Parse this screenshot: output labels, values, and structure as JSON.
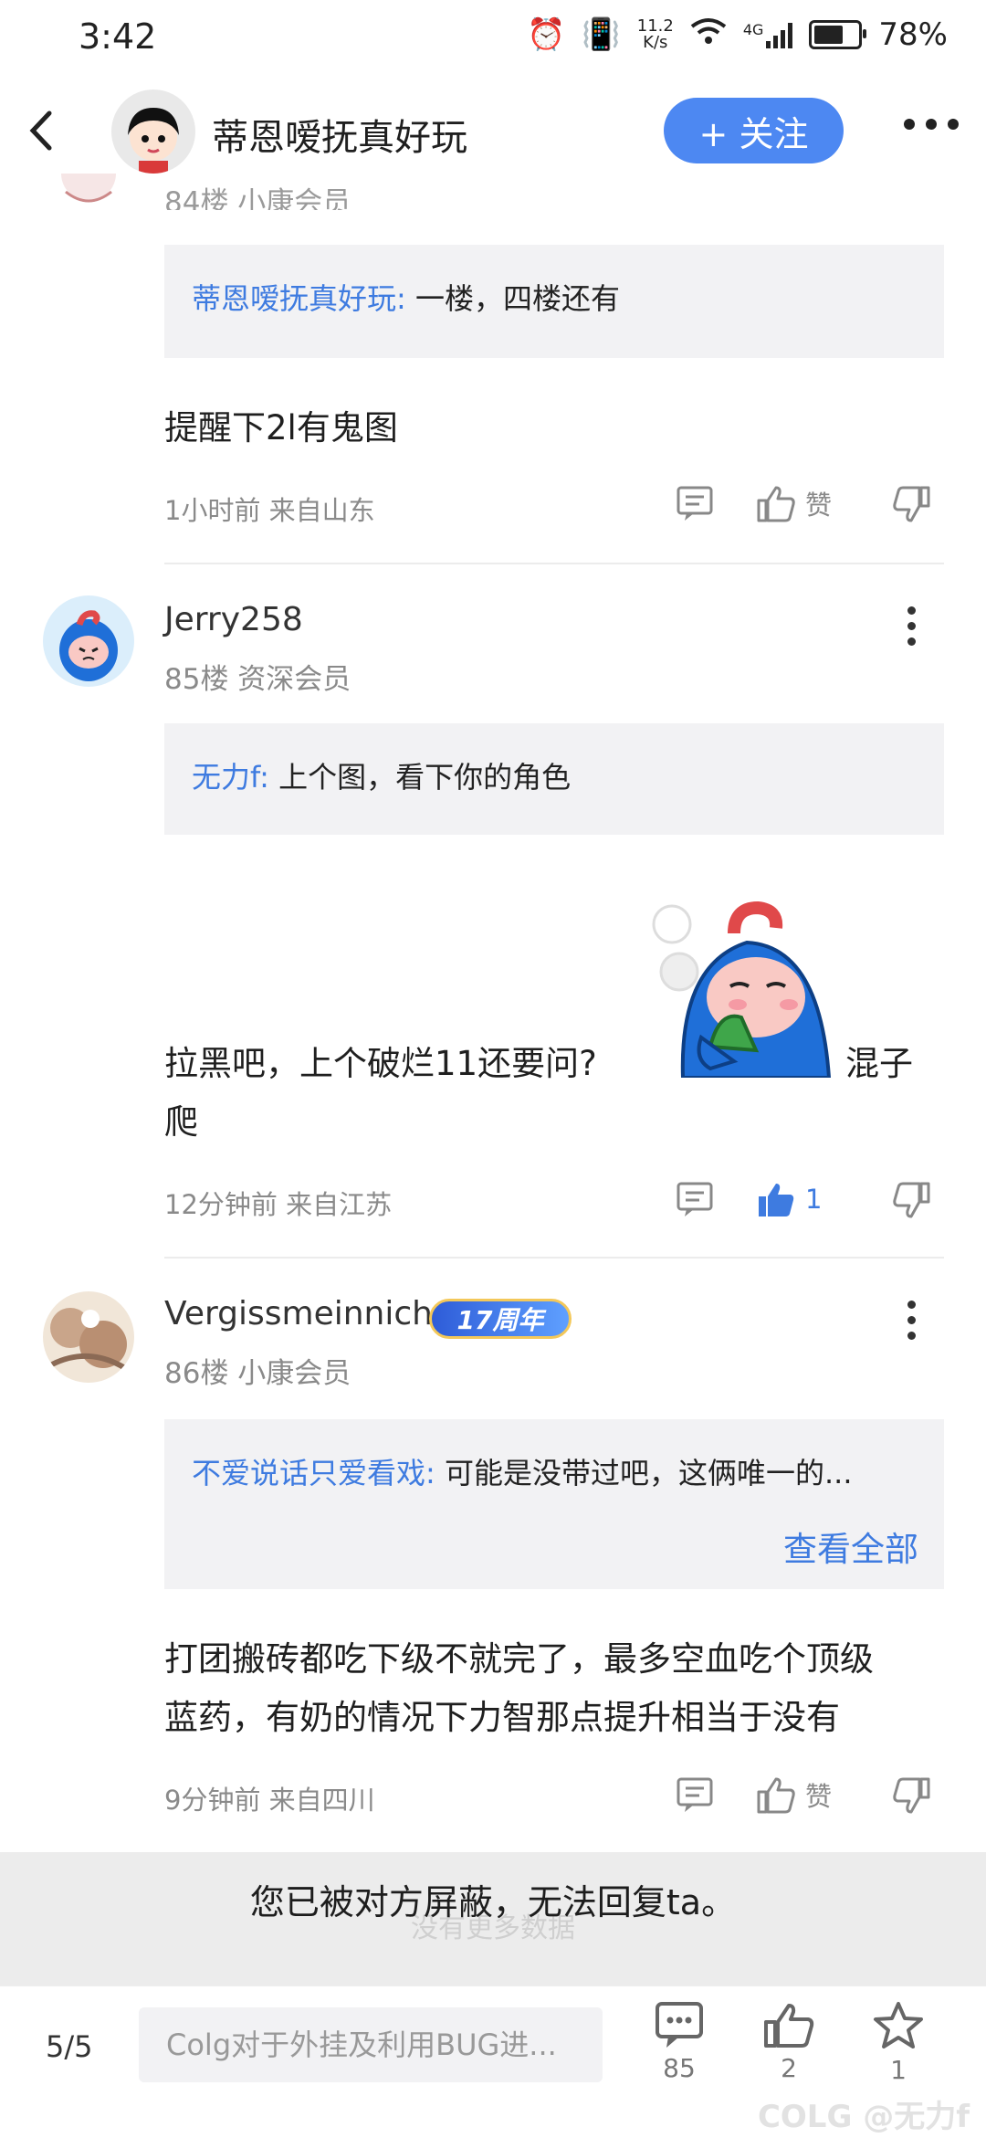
{
  "status_bar": {
    "time": "3:42",
    "net_speed_value": "11.2",
    "net_speed_unit": "K/s",
    "network": "4G",
    "battery": "78%",
    "battery_level": 0.78
  },
  "header": {
    "title": "蒂恩嗳抚真好玩",
    "follow_label": "+ 关注"
  },
  "post_84": {
    "meta": "84楼 小康会员",
    "quote_author": "蒂恩嗳抚真好玩:",
    "quote_text": "一楼，四楼还有",
    "content": "提醒下2l有鬼图",
    "time_location": "1小时前 来自山东",
    "like_label": "赞"
  },
  "post_85": {
    "username": "Jerry258",
    "meta": "85楼 资深会员",
    "quote_author": "无力f:",
    "quote_text": "上个图，看下你的角色",
    "content_line1": "拉黑吧，上个破烂11还要问?",
    "content_after_sticker": "混子",
    "content_line2": "爬",
    "time_location": "12分钟前 来自江苏",
    "like_count": "1"
  },
  "post_86": {
    "username": "Vergissmeinnich",
    "badge": "17周年",
    "meta": "86楼 小康会员",
    "quote_author": "不爱说话只爱看戏:",
    "quote_text": "可能是没带过吧，这俩唯一的...",
    "view_all": "查看全部",
    "content_line1": "打团搬砖都吃下级不就完了，最多空血吃个顶级",
    "content_line2": "蓝药，有奶的情况下力智那点提升相当于没有",
    "time_location": "9分钟前 来自四川",
    "like_label": "赞"
  },
  "toast": {
    "message": "您已被对方屏蔽，无法回复ta。",
    "ghost_text": "没有更多数据"
  },
  "bottom_bar": {
    "page": "5/5",
    "reply_placeholder": "Colg对于外挂及利用BUG进...",
    "comment_count": "85",
    "like_count": "2",
    "fav_count": "1"
  },
  "watermark": "COLG @无力f",
  "colors": {
    "accent": "#4d88f2",
    "link": "#3e7be0",
    "quote_bg": "#f2f2f4"
  },
  "icons": [
    "back-icon",
    "more-icon",
    "comment-icon",
    "thumb-up-icon",
    "thumb-down-icon",
    "kebab-icon",
    "star-icon"
  ]
}
